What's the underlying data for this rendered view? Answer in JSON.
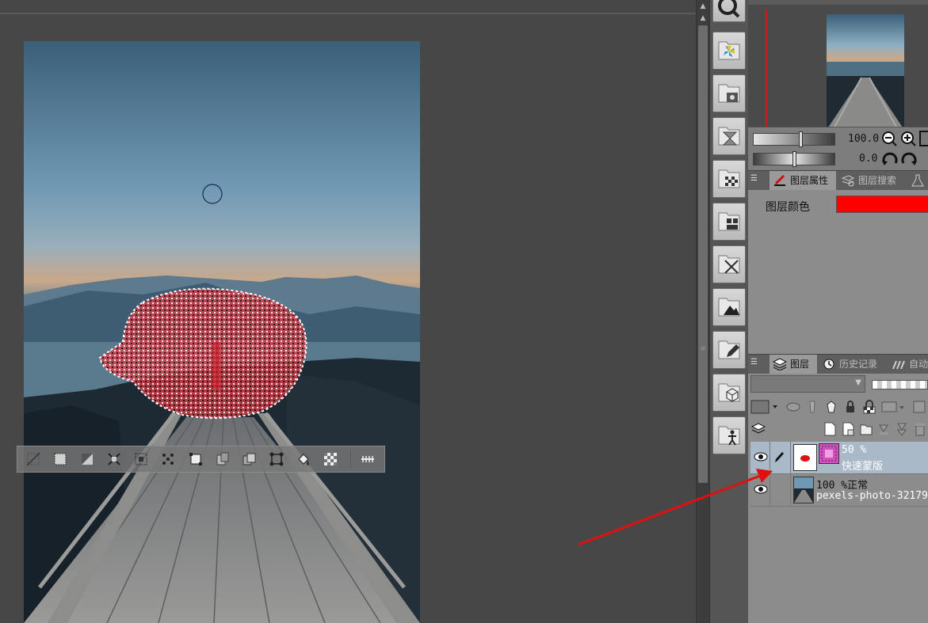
{
  "colors": {
    "workspace": "#474747",
    "panel": "#8c8c8c",
    "selection_mask": "#e0404a",
    "layer_color": "#ff0000",
    "annotation_arrow": "#e01010"
  },
  "floating_toolbar": {
    "buttons": [
      "deselect-icon",
      "crop-selection-icon",
      "invert-selection-icon",
      "expand-selection-icon",
      "shrink-selection-icon",
      "scatter-selection-icon",
      "free-transform-icon",
      "copy-paste-icon",
      "duplicate-icon",
      "transform-icon",
      "fill-icon",
      "clear-icon",
      "more-options-icon"
    ]
  },
  "tool_column": {
    "buttons": [
      "zoom-q-icon",
      "pinwheel-material-icon",
      "folder-image-icon",
      "folder-hourglass-icon",
      "checker-pattern-icon",
      "folder-grid-icon",
      "folder-burst-icon",
      "folder-mountain-icon",
      "folder-pencil-icon",
      "folder-cube-icon",
      "folder-figure-icon"
    ]
  },
  "navigator": {
    "zoom_value": "100.0",
    "rotate_value": "0.0"
  },
  "properties_panel": {
    "tabs": [
      {
        "label": "图层属性",
        "active": true
      },
      {
        "label": "图层搜索",
        "active": false
      }
    ],
    "layer_color_label": "图层颜色"
  },
  "layers_panel": {
    "tabs": [
      {
        "label": "图层",
        "active": true
      },
      {
        "label": "历史记录",
        "active": false
      },
      {
        "label": "自动",
        "active": false
      }
    ],
    "layers": [
      {
        "opacity_line": "50 %",
        "name": "快速蒙版",
        "selected": true
      },
      {
        "opacity_line": "100 %正常",
        "name": "pexels-photo-32179",
        "selected": false
      }
    ]
  }
}
